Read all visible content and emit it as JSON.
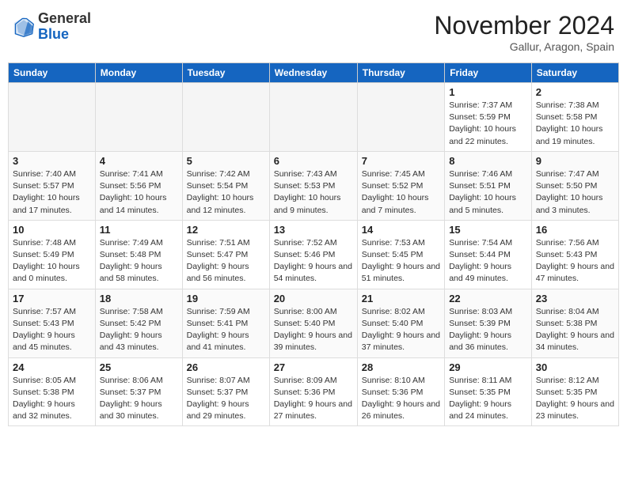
{
  "header": {
    "logo_general": "General",
    "logo_blue": "Blue",
    "month_title": "November 2024",
    "location": "Gallur, Aragon, Spain"
  },
  "days_of_week": [
    "Sunday",
    "Monday",
    "Tuesday",
    "Wednesday",
    "Thursday",
    "Friday",
    "Saturday"
  ],
  "weeks": [
    [
      {
        "day": "",
        "info": ""
      },
      {
        "day": "",
        "info": ""
      },
      {
        "day": "",
        "info": ""
      },
      {
        "day": "",
        "info": ""
      },
      {
        "day": "",
        "info": ""
      },
      {
        "day": "1",
        "info": "Sunrise: 7:37 AM\nSunset: 5:59 PM\nDaylight: 10 hours and 22 minutes."
      },
      {
        "day": "2",
        "info": "Sunrise: 7:38 AM\nSunset: 5:58 PM\nDaylight: 10 hours and 19 minutes."
      }
    ],
    [
      {
        "day": "3",
        "info": "Sunrise: 7:40 AM\nSunset: 5:57 PM\nDaylight: 10 hours and 17 minutes."
      },
      {
        "day": "4",
        "info": "Sunrise: 7:41 AM\nSunset: 5:56 PM\nDaylight: 10 hours and 14 minutes."
      },
      {
        "day": "5",
        "info": "Sunrise: 7:42 AM\nSunset: 5:54 PM\nDaylight: 10 hours and 12 minutes."
      },
      {
        "day": "6",
        "info": "Sunrise: 7:43 AM\nSunset: 5:53 PM\nDaylight: 10 hours and 9 minutes."
      },
      {
        "day": "7",
        "info": "Sunrise: 7:45 AM\nSunset: 5:52 PM\nDaylight: 10 hours and 7 minutes."
      },
      {
        "day": "8",
        "info": "Sunrise: 7:46 AM\nSunset: 5:51 PM\nDaylight: 10 hours and 5 minutes."
      },
      {
        "day": "9",
        "info": "Sunrise: 7:47 AM\nSunset: 5:50 PM\nDaylight: 10 hours and 3 minutes."
      }
    ],
    [
      {
        "day": "10",
        "info": "Sunrise: 7:48 AM\nSunset: 5:49 PM\nDaylight: 10 hours and 0 minutes."
      },
      {
        "day": "11",
        "info": "Sunrise: 7:49 AM\nSunset: 5:48 PM\nDaylight: 9 hours and 58 minutes."
      },
      {
        "day": "12",
        "info": "Sunrise: 7:51 AM\nSunset: 5:47 PM\nDaylight: 9 hours and 56 minutes."
      },
      {
        "day": "13",
        "info": "Sunrise: 7:52 AM\nSunset: 5:46 PM\nDaylight: 9 hours and 54 minutes."
      },
      {
        "day": "14",
        "info": "Sunrise: 7:53 AM\nSunset: 5:45 PM\nDaylight: 9 hours and 51 minutes."
      },
      {
        "day": "15",
        "info": "Sunrise: 7:54 AM\nSunset: 5:44 PM\nDaylight: 9 hours and 49 minutes."
      },
      {
        "day": "16",
        "info": "Sunrise: 7:56 AM\nSunset: 5:43 PM\nDaylight: 9 hours and 47 minutes."
      }
    ],
    [
      {
        "day": "17",
        "info": "Sunrise: 7:57 AM\nSunset: 5:43 PM\nDaylight: 9 hours and 45 minutes."
      },
      {
        "day": "18",
        "info": "Sunrise: 7:58 AM\nSunset: 5:42 PM\nDaylight: 9 hours and 43 minutes."
      },
      {
        "day": "19",
        "info": "Sunrise: 7:59 AM\nSunset: 5:41 PM\nDaylight: 9 hours and 41 minutes."
      },
      {
        "day": "20",
        "info": "Sunrise: 8:00 AM\nSunset: 5:40 PM\nDaylight: 9 hours and 39 minutes."
      },
      {
        "day": "21",
        "info": "Sunrise: 8:02 AM\nSunset: 5:40 PM\nDaylight: 9 hours and 37 minutes."
      },
      {
        "day": "22",
        "info": "Sunrise: 8:03 AM\nSunset: 5:39 PM\nDaylight: 9 hours and 36 minutes."
      },
      {
        "day": "23",
        "info": "Sunrise: 8:04 AM\nSunset: 5:38 PM\nDaylight: 9 hours and 34 minutes."
      }
    ],
    [
      {
        "day": "24",
        "info": "Sunrise: 8:05 AM\nSunset: 5:38 PM\nDaylight: 9 hours and 32 minutes."
      },
      {
        "day": "25",
        "info": "Sunrise: 8:06 AM\nSunset: 5:37 PM\nDaylight: 9 hours and 30 minutes."
      },
      {
        "day": "26",
        "info": "Sunrise: 8:07 AM\nSunset: 5:37 PM\nDaylight: 9 hours and 29 minutes."
      },
      {
        "day": "27",
        "info": "Sunrise: 8:09 AM\nSunset: 5:36 PM\nDaylight: 9 hours and 27 minutes."
      },
      {
        "day": "28",
        "info": "Sunrise: 8:10 AM\nSunset: 5:36 PM\nDaylight: 9 hours and 26 minutes."
      },
      {
        "day": "29",
        "info": "Sunrise: 8:11 AM\nSunset: 5:35 PM\nDaylight: 9 hours and 24 minutes."
      },
      {
        "day": "30",
        "info": "Sunrise: 8:12 AM\nSunset: 5:35 PM\nDaylight: 9 hours and 23 minutes."
      }
    ]
  ]
}
